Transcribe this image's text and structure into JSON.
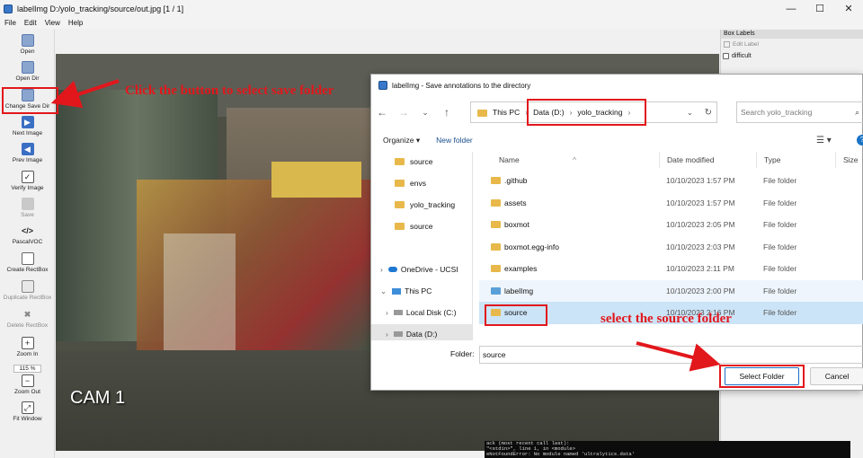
{
  "window": {
    "title": "labelImg D:/yolo_tracking/source/out.jpg [1 / 1]",
    "controls": [
      "—",
      "☐",
      "✕"
    ]
  },
  "menu": [
    "File",
    "Edit",
    "View",
    "Help"
  ],
  "toolbar": [
    {
      "label": "Open"
    },
    {
      "label": "Open Dir"
    },
    {
      "label": "Change Save Dir"
    },
    {
      "label": "Next Image"
    },
    {
      "label": "Prev Image"
    },
    {
      "label": "Verify Image"
    },
    {
      "label": "Save"
    },
    {
      "label": "PascalVOC"
    },
    {
      "label": "Create RectBox"
    },
    {
      "label": "Duplicate RectBox"
    },
    {
      "label": "Delete RectBox"
    },
    {
      "label": "Zoom In"
    },
    {
      "label": "115 %"
    },
    {
      "label": "Zoom Out"
    },
    {
      "label": "Fit Window"
    }
  ],
  "canvas": {
    "cam_label": "CAM 1"
  },
  "box_labels": {
    "header": "Box Labels",
    "edit_label": "Edit Label",
    "difficult": "difficult"
  },
  "dialog": {
    "title": "labelImg - Save annotations to the directory",
    "address": {
      "root": "This PC",
      "drive": "Data (D:)",
      "folder": "yolo_tracking"
    },
    "search_placeholder": "Search yolo_tracking",
    "organize": "Organize ▾",
    "new_folder": "New folder",
    "nav_items": [
      "source",
      "envs",
      "yolo_tracking",
      "source",
      "OneDrive - UCSI",
      "This PC",
      "Local Disk (C:)",
      "Data (D:)"
    ],
    "columns": {
      "name": "Name",
      "date": "Date modified",
      "type": "Type",
      "size": "Size"
    },
    "files": [
      {
        "name": ".github",
        "date": "10/10/2023 1:57 PM",
        "type": "File folder"
      },
      {
        "name": "assets",
        "date": "10/10/2023 1:57 PM",
        "type": "File folder"
      },
      {
        "name": "boxmot",
        "date": "10/10/2023 2:05 PM",
        "type": "File folder"
      },
      {
        "name": "boxmot.egg-info",
        "date": "10/10/2023 2:03 PM",
        "type": "File folder"
      },
      {
        "name": "examples",
        "date": "10/10/2023 2:11 PM",
        "type": "File folder"
      },
      {
        "name": "labelImg",
        "date": "10/10/2023 2:00 PM",
        "type": "File folder"
      },
      {
        "name": "source",
        "date": "10/10/2023 2:16 PM",
        "type": "File folder"
      }
    ],
    "folder_label": "Folder:",
    "folder_value": "source",
    "select_button": "Select Folder",
    "cancel_button": "Cancel"
  },
  "annotations": {
    "save_dir": "Click the button to select save folder",
    "source_folder": "select the source folder"
  },
  "terminal": [
    "ack (most recent call last):",
    "  \"<stdin>\", line 1, in <module>",
    "eNotFoundError: No module named 'ultralytics.data'"
  ],
  "colors": {
    "annotation_red": "#e2171c",
    "selection_blue": "#cce4f7",
    "folder_yellow": "#e8b94a"
  }
}
